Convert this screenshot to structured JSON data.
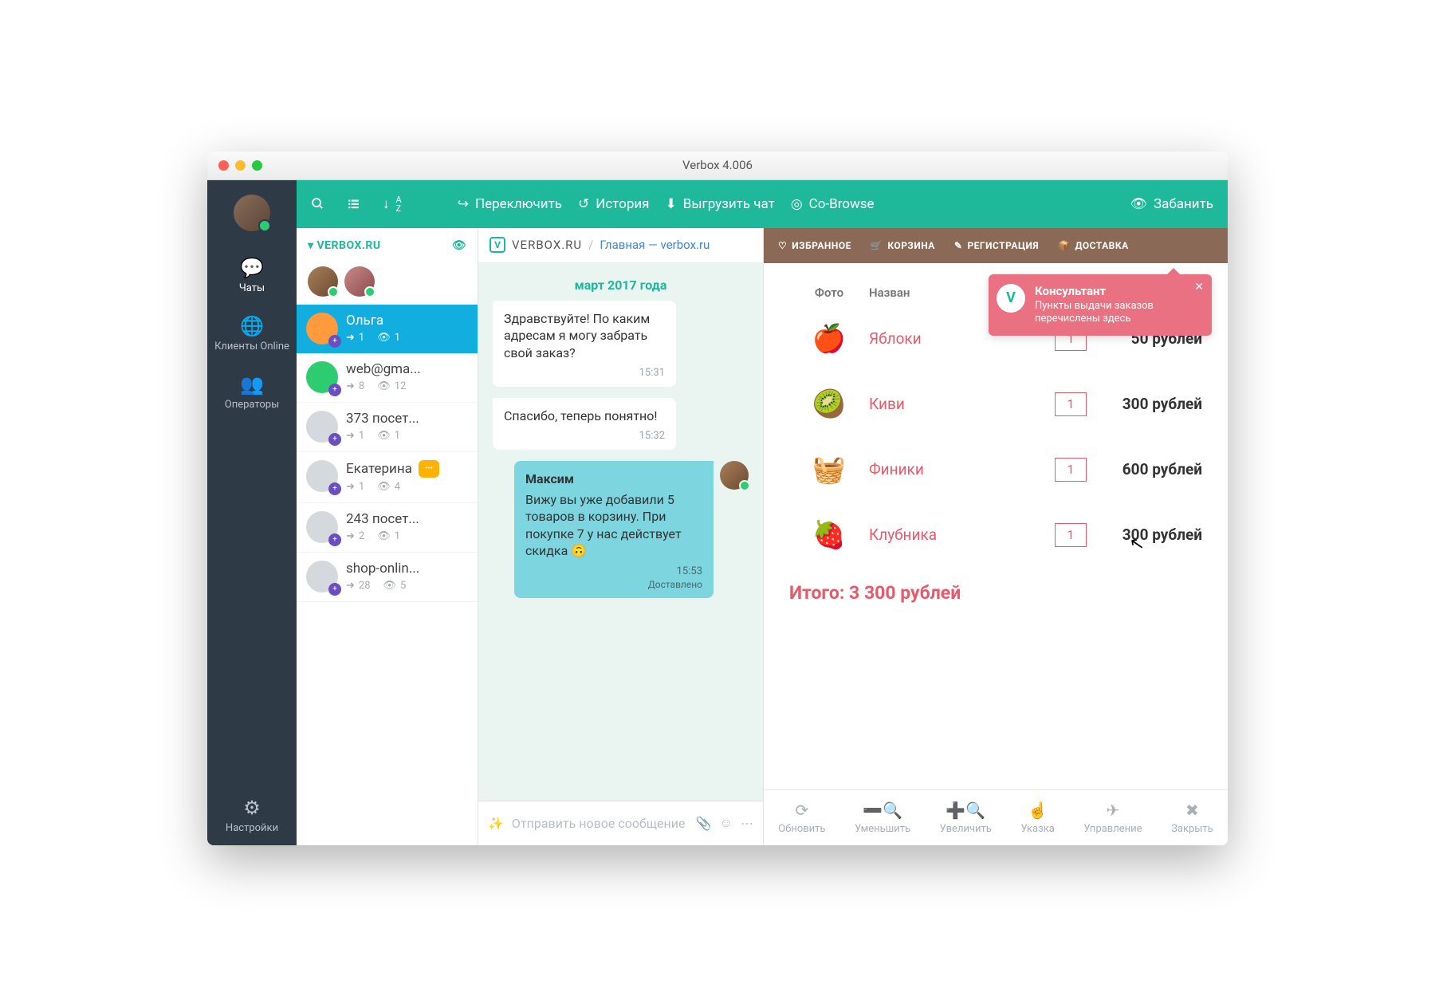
{
  "window": {
    "title": "Verbox 4.006"
  },
  "sidebar": {
    "items": [
      {
        "label": "Чаты"
      },
      {
        "label": "Клиенты Online"
      },
      {
        "label": "Операторы"
      }
    ],
    "settings": "Настройки"
  },
  "topbar": {
    "switch": "Переключить",
    "history": "История",
    "export": "Выгрузить чат",
    "cobrowse": "Co-Browse",
    "ban": "Забанить"
  },
  "chatlist": {
    "site": "VERBOX.RU",
    "items": [
      {
        "name": "Ольга",
        "in": "1",
        "views": "1"
      },
      {
        "name": "web@gma...",
        "in": "8",
        "views": "12"
      },
      {
        "name": "373 посет...",
        "in": "1",
        "views": "1"
      },
      {
        "name": "Екатерина",
        "in": "1",
        "views": "4"
      },
      {
        "name": "243 посет...",
        "in": "2",
        "views": "1"
      },
      {
        "name": "shop-onlin...",
        "in": "28",
        "views": "5"
      }
    ]
  },
  "convo": {
    "breadcrumb_site": "VERBOX.RU",
    "breadcrumb_sep": "/",
    "breadcrumb_page": "Главная — verbox.ru",
    "date": "март 2017 года",
    "messages": [
      {
        "text": "Здравствуйте! По каким адресам я могу забрать свой заказ?",
        "time": "15:31"
      },
      {
        "text": "Спасибо, теперь понятно!",
        "time": "15:32"
      }
    ],
    "out": {
      "sender": "Максим",
      "text": "Вижу вы уже добавили 5 товаров в корзину. При покупке 7 у нас действует скидка",
      "emoji": "🙃",
      "time": "15:53",
      "status": "Доставлено"
    },
    "compose_placeholder": "Отправить новое сообщение"
  },
  "shop": {
    "menu": {
      "fav": "ИЗБРАННОЕ",
      "cart": "КОРЗИНА",
      "reg": "РЕГИСТРАЦИЯ",
      "delivery": "ДОСТАВКА"
    },
    "headers": {
      "photo": "Фото",
      "name": "Назван"
    },
    "products": [
      {
        "name": "Яблоки",
        "qty": "1",
        "price": "50 рублей",
        "emoji": "🍎"
      },
      {
        "name": "Киви",
        "qty": "1",
        "price": "300 рублей",
        "emoji": "🥝"
      },
      {
        "name": "Финики",
        "qty": "1",
        "price": "600 рублей",
        "emoji": "🧺"
      },
      {
        "name": "Клубника",
        "qty": "1",
        "price": "300 рублей",
        "emoji": "🍓"
      }
    ],
    "total": "Итого: 3 300 рублей",
    "tooltip": {
      "title": "Консультант",
      "text": "Пункты выдачи заказов перечислены здесь"
    },
    "footer": {
      "refresh": "Обновить",
      "zoomout": "Уменьшить",
      "zoomin": "Увеличить",
      "pointer": "Указка",
      "control": "Управление",
      "close": "Закрыть"
    }
  }
}
